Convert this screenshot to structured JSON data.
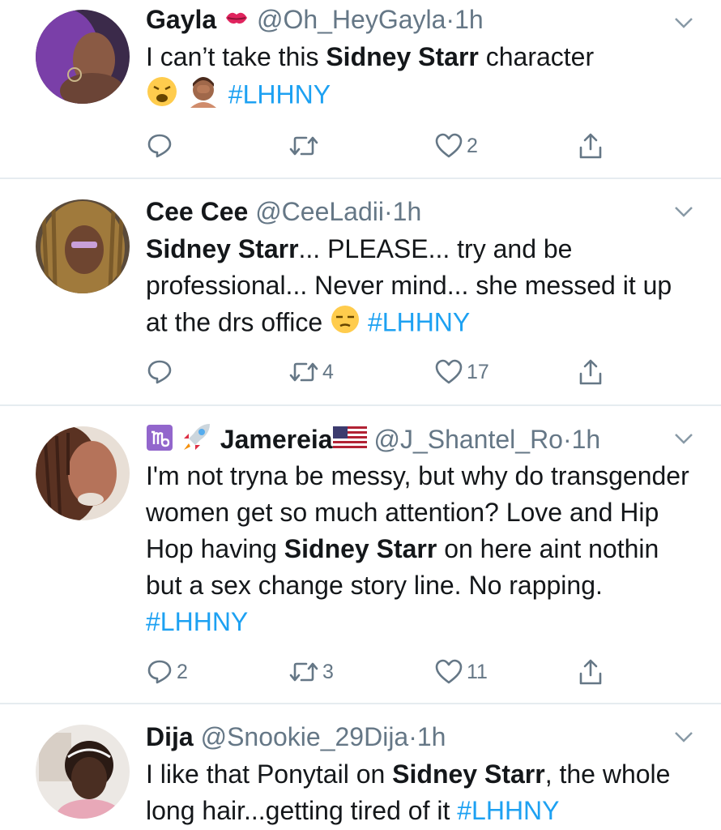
{
  "tweets": [
    {
      "name": "Gayla",
      "handle": "@Oh_HeyGayla",
      "dot": "·",
      "time": "1h",
      "text": {
        "t1": "I can’t take this ",
        "b1": "Sidney Starr",
        "t2": " character",
        "tag": "#LHHNY"
      },
      "reply_count": "",
      "retweet_count": "",
      "like_count": "2",
      "icons": [
        "kiss-mark-emoji",
        "weary-face-emoji",
        "facepalm-emoji"
      ]
    },
    {
      "name": "Cee Cee",
      "handle": "@CeeLadii",
      "dot": "·",
      "time": "1h",
      "text": {
        "b1": "Sidney Starr",
        "t1": "... PLEASE... try and be professional... Never mind... she messed it up at the drs office ",
        "tag": "#LHHNY"
      },
      "reply_count": "",
      "retweet_count": "4",
      "like_count": "17",
      "icons": [
        "unamused-face-emoji"
      ]
    },
    {
      "name": "Jamereia",
      "handle": "@J_Shantel_Ro",
      "dot": "·",
      "time": "1h",
      "text": {
        "t1": "I'm not tryna be messy, but why do transgender women get so much attention? Love and Hip Hop having ",
        "b1": "Sidney Starr",
        "t2": " on here aint nothin but a sex change story line. No rapping. ",
        "tag": "#LHHNY"
      },
      "reply_count": "2",
      "retweet_count": "3",
      "like_count": "11",
      "icons": [
        "capricorn-emoji",
        "rocket-emoji",
        "us-flag-emoji"
      ]
    },
    {
      "name": "Dija",
      "handle": "@Snookie_29Dija",
      "dot": "·",
      "time": "1h",
      "text": {
        "t1": "I like that Ponytail on ",
        "b1": "Sidney Starr",
        "t2": ", the whole long hair...getting tired of it ",
        "tag": "#LHHNY"
      }
    }
  ],
  "colors": {
    "link": "#1da1f2",
    "muted": "#657786",
    "separator": "#e6ecf0"
  }
}
